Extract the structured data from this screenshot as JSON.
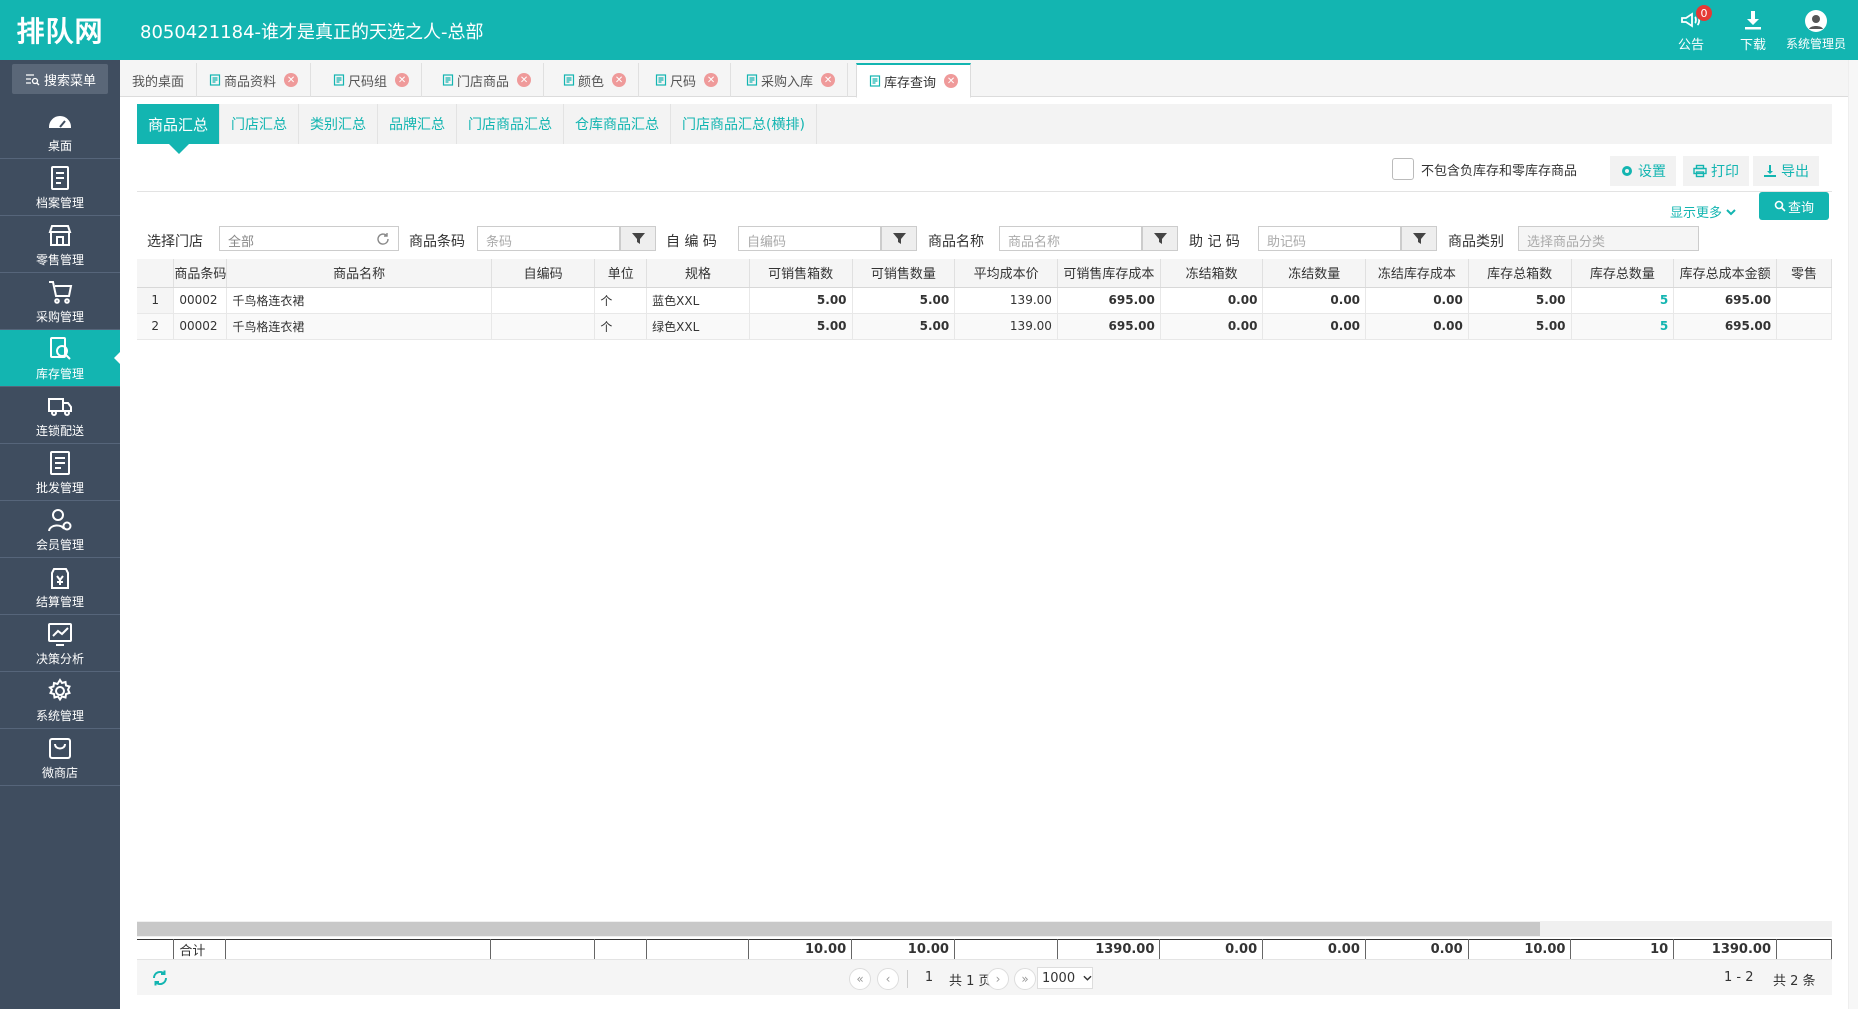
{
  "app": {
    "logo_text": "排队网",
    "shop_title": "8050421184-谁才是真正的天选之人-总部",
    "announcement_label": "公告",
    "announcement_count": "0",
    "download_label": "下载",
    "user_label": "系统管理员",
    "accent_color": "#13b5b1",
    "sidebar_color": "#3f4d5f"
  },
  "sidebar": {
    "search_label": "搜索菜单",
    "items": [
      {
        "label": "桌面",
        "icon": "dashboard-icon"
      },
      {
        "label": "档案管理",
        "icon": "archive-icon"
      },
      {
        "label": "零售管理",
        "icon": "store-icon"
      },
      {
        "label": "采购管理",
        "icon": "cart-icon"
      },
      {
        "label": "库存管理",
        "icon": "inventory-search-icon",
        "active": true
      },
      {
        "label": "连锁配送",
        "icon": "truck-icon"
      },
      {
        "label": "批发管理",
        "icon": "wholesale-icon"
      },
      {
        "label": "会员管理",
        "icon": "member-icon"
      },
      {
        "label": "结算管理",
        "icon": "settlement-icon"
      },
      {
        "label": "决策分析",
        "icon": "chart-icon"
      },
      {
        "label": "系统管理",
        "icon": "gear-icon"
      },
      {
        "label": "微商店",
        "icon": "bag-icon"
      }
    ]
  },
  "tabs": [
    {
      "label": "我的桌面"
    },
    {
      "label": "商品资料"
    },
    {
      "label": "尺码组"
    },
    {
      "label": "门店商品"
    },
    {
      "label": "颜色"
    },
    {
      "label": "尺码"
    },
    {
      "label": "采购入库"
    },
    {
      "label": "库存查询",
      "active": true
    }
  ],
  "subtabs": [
    {
      "label": "商品汇总",
      "active": true
    },
    {
      "label": "门店汇总"
    },
    {
      "label": "类别汇总"
    },
    {
      "label": "品牌汇总"
    },
    {
      "label": "门店商品汇总"
    },
    {
      "label": "仓库商品汇总"
    },
    {
      "label": "门店商品汇总(横排)"
    }
  ],
  "options": {
    "exclude_label": "不包含负库存和零库存商品",
    "settings_label": "设置",
    "print_label": "打印",
    "export_label": "导出",
    "show_more_label": "显示更多",
    "query_label": "查询"
  },
  "filters": {
    "store_label": "选择门店",
    "store_value": "全部",
    "barcode_label": "商品条码",
    "barcode_placeholder": "条码",
    "selfcode_label": "自 编 码",
    "selfcode_placeholder": "自编码",
    "name_label": "商品名称",
    "name_placeholder": "商品名称",
    "mnemonic_label": "助 记 码",
    "mnemonic_placeholder": "助记码",
    "category_label": "商品类别",
    "category_placeholder": "选择商品分类"
  },
  "table": {
    "headers": [
      "",
      "商品条码",
      "商品名称",
      "自编码",
      "单位",
      "规格",
      "可销售箱数",
      "可销售数量",
      "平均成本价",
      "可销售库存成本",
      "冻结箱数",
      "冻结数量",
      "冻结库存成本",
      "库存总箱数",
      "库存总数量",
      "库存总成本金额",
      "零售"
    ],
    "rows": [
      [
        "1",
        "00002",
        "千鸟格连衣裙",
        "",
        "个",
        "蓝色XXL",
        "5.00",
        "5.00",
        "139.00",
        "695.00",
        "0.00",
        "0.00",
        "0.00",
        "5.00",
        "5",
        "695.00",
        ""
      ],
      [
        "2",
        "00002",
        "千鸟格连衣裙",
        "",
        "个",
        "绿色XXL",
        "5.00",
        "5.00",
        "139.00",
        "695.00",
        "0.00",
        "0.00",
        "0.00",
        "5.00",
        "5",
        "695.00",
        ""
      ]
    ],
    "footer": [
      "",
      "合计",
      "",
      "",
      "",
      "",
      "10.00",
      "10.00",
      "",
      "1390.00",
      "0.00",
      "0.00",
      "0.00",
      "10.00",
      "10",
      "1390.00",
      ""
    ]
  },
  "pager": {
    "current_page": "1",
    "total_pages": "共 1 页",
    "page_size": "1000",
    "range": "1 - 2",
    "total_count": "共 2 条"
  }
}
